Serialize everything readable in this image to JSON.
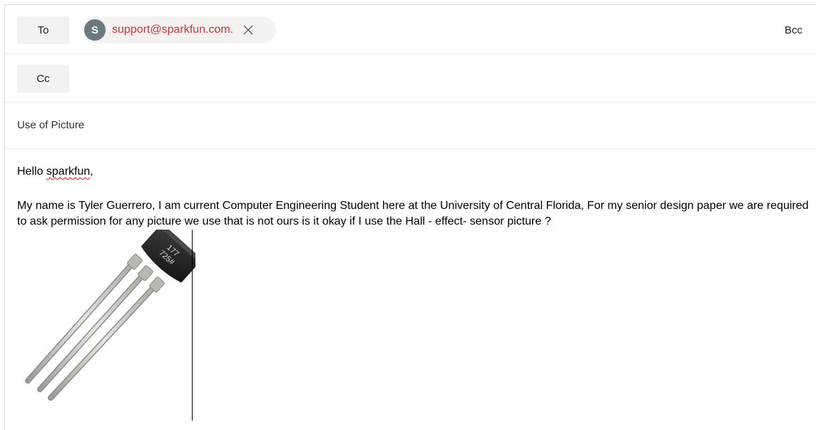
{
  "to_row": {
    "label": "To",
    "recipient": {
      "avatar_initial": "S",
      "email": "support@sparkfun.com.",
      "remove_icon": "close-icon"
    },
    "bcc_label": "Bcc"
  },
  "cc_row": {
    "label": "Cc"
  },
  "subject": {
    "value": "Use of Picture"
  },
  "body": {
    "greeting_prefix": "Hello ",
    "greeting_name": "sparkfun",
    "greeting_suffix": ",",
    "paragraph": "My name is Tyler Guerrero, I am current Computer Engineering Student here at the University of Central Florida, For my senior design paper we are required to ask permission for any picture we use that is not ours is it okay if I use the Hall - effect- sensor picture ?",
    "image": {
      "chip_marking_line1": "177",
      "chip_marking_line2": "725#"
    }
  },
  "colors": {
    "recipient_text": "#d13438",
    "avatar_bg": "#69797e",
    "button_bg": "#f3f2f1",
    "spellcheck": "#e81123"
  }
}
